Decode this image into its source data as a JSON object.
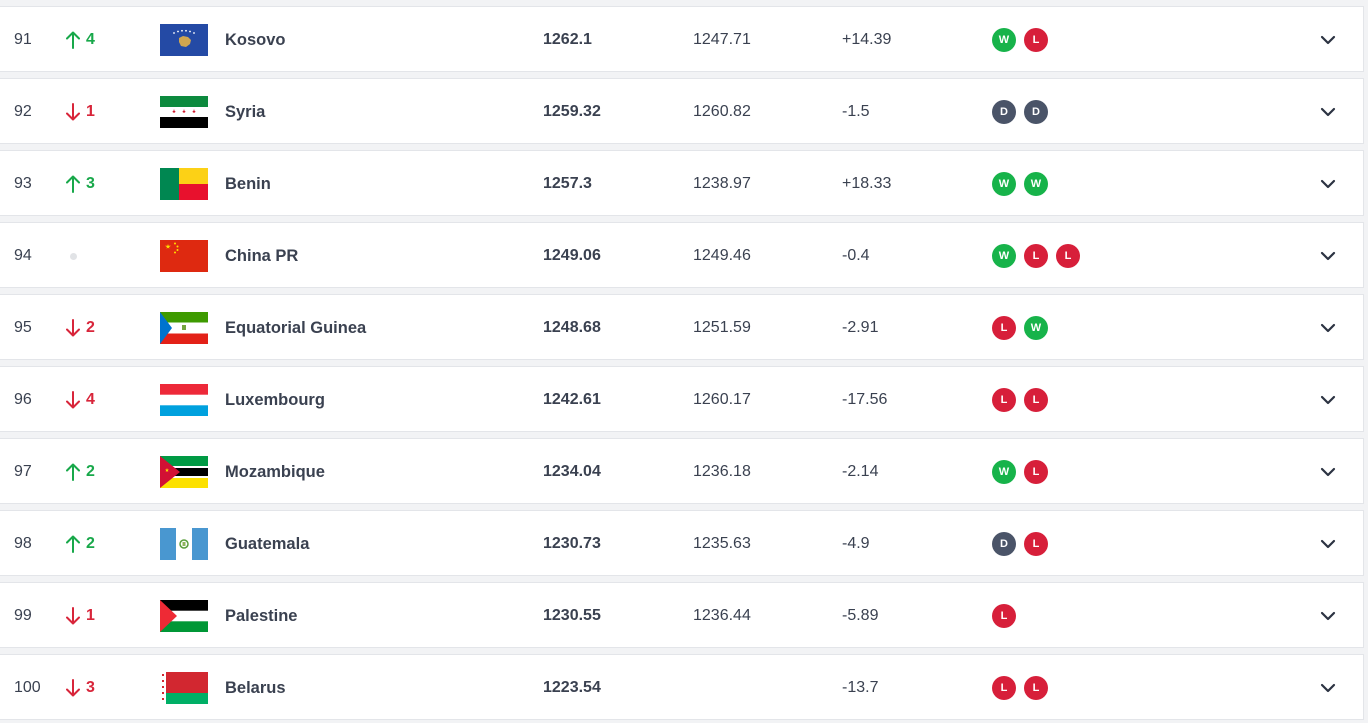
{
  "colors": {
    "up": "#18a84a",
    "down": "#d8253a",
    "win": "#17b34a",
    "loss": "#d71f3a",
    "draw": "#4a5468"
  },
  "rows": [
    {
      "rank": "91",
      "move": "up",
      "move_value": "4",
      "flag": "kosovo",
      "country": "Kosovo",
      "total": "1262.1",
      "previous": "1247.71",
      "diff": "+14.39",
      "results": [
        "W",
        "L"
      ]
    },
    {
      "rank": "92",
      "move": "down",
      "move_value": "1",
      "flag": "syria",
      "country": "Syria",
      "total": "1259.32",
      "previous": "1260.82",
      "diff": "-1.5",
      "results": [
        "D",
        "D"
      ]
    },
    {
      "rank": "93",
      "move": "up",
      "move_value": "3",
      "flag": "benin",
      "country": "Benin",
      "total": "1257.3",
      "previous": "1238.97",
      "diff": "+18.33",
      "results": [
        "W",
        "W"
      ]
    },
    {
      "rank": "94",
      "move": "same",
      "move_value": "",
      "flag": "china",
      "country": "China PR",
      "total": "1249.06",
      "previous": "1249.46",
      "diff": "-0.4",
      "results": [
        "W",
        "L",
        "L"
      ]
    },
    {
      "rank": "95",
      "move": "down",
      "move_value": "2",
      "flag": "equatorial-guinea",
      "country": "Equatorial Guinea",
      "total": "1248.68",
      "previous": "1251.59",
      "diff": "-2.91",
      "results": [
        "L",
        "W"
      ]
    },
    {
      "rank": "96",
      "move": "down",
      "move_value": "4",
      "flag": "luxembourg",
      "country": "Luxembourg",
      "total": "1242.61",
      "previous": "1260.17",
      "diff": "-17.56",
      "results": [
        "L",
        "L"
      ]
    },
    {
      "rank": "97",
      "move": "up",
      "move_value": "2",
      "flag": "mozambique",
      "country": "Mozambique",
      "total": "1234.04",
      "previous": "1236.18",
      "diff": "-2.14",
      "results": [
        "W",
        "L"
      ]
    },
    {
      "rank": "98",
      "move": "up",
      "move_value": "2",
      "flag": "guatemala",
      "country": "Guatemala",
      "total": "1230.73",
      "previous": "1235.63",
      "diff": "-4.9",
      "results": [
        "D",
        "L"
      ]
    },
    {
      "rank": "99",
      "move": "down",
      "move_value": "1",
      "flag": "palestine",
      "country": "Palestine",
      "total": "1230.55",
      "previous": "1236.44",
      "diff": "-5.89",
      "results": [
        "L"
      ]
    },
    {
      "rank": "100",
      "move": "down",
      "move_value": "3",
      "flag": "belarus",
      "country": "Belarus",
      "total": "1223.54",
      "previous": "",
      "diff": "-13.7",
      "results": [
        "L",
        "L"
      ]
    }
  ]
}
